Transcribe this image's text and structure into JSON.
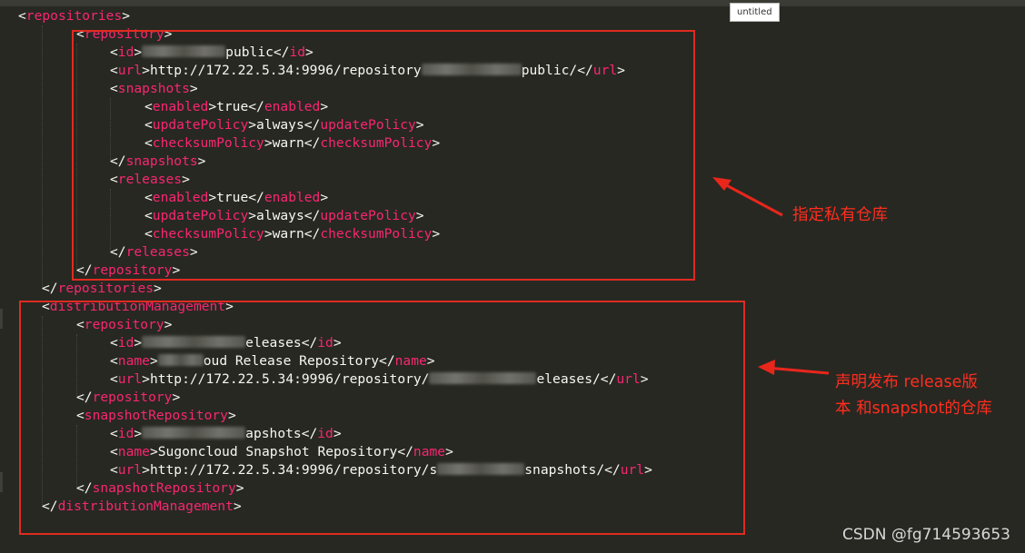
{
  "tab": {
    "label": "untitled"
  },
  "lines": [
    {
      "indent": 0,
      "parts": [
        [
          "br",
          "<"
        ],
        [
          "tn",
          "repositories"
        ],
        [
          "br",
          ">"
        ]
      ]
    },
    {
      "indent": 2,
      "parts": [
        [
          "br",
          "<"
        ],
        [
          "tn",
          "repository"
        ],
        [
          "br",
          ">"
        ]
      ]
    },
    {
      "indent": 3,
      "parts": [
        [
          "br",
          "<"
        ],
        [
          "tn",
          "id"
        ],
        [
          "br",
          ">"
        ],
        [
          "blur",
          ""
        ],
        [
          "tx",
          "public"
        ],
        [
          "br",
          "</"
        ],
        [
          "tn",
          "id"
        ],
        [
          "br",
          ">"
        ]
      ]
    },
    {
      "indent": 3,
      "parts": [
        [
          "br",
          "<"
        ],
        [
          "tn",
          "url"
        ],
        [
          "br",
          ">"
        ],
        [
          "tx",
          "http://172.22.5.34:9996/repository"
        ],
        [
          "blur",
          ""
        ],
        [
          "tx",
          "public/"
        ],
        [
          "br",
          "</"
        ],
        [
          "tn",
          "url"
        ],
        [
          "br",
          ">"
        ]
      ]
    },
    {
      "indent": 3,
      "parts": [
        [
          "br",
          "<"
        ],
        [
          "tn",
          "snapshots"
        ],
        [
          "br",
          ">"
        ]
      ]
    },
    {
      "indent": 4,
      "parts": [
        [
          "br",
          "<"
        ],
        [
          "tn",
          "enabled"
        ],
        [
          "br",
          ">"
        ],
        [
          "tx",
          "true"
        ],
        [
          "br",
          "</"
        ],
        [
          "tn",
          "enabled"
        ],
        [
          "br",
          ">"
        ]
      ]
    },
    {
      "indent": 4,
      "parts": [
        [
          "br",
          "<"
        ],
        [
          "tn",
          "updatePolicy"
        ],
        [
          "br",
          ">"
        ],
        [
          "tx",
          "always"
        ],
        [
          "br",
          "</"
        ],
        [
          "tn",
          "updatePolicy"
        ],
        [
          "br",
          ">"
        ]
      ]
    },
    {
      "indent": 4,
      "parts": [
        [
          "br",
          "<"
        ],
        [
          "tn",
          "checksumPolicy"
        ],
        [
          "br",
          ">"
        ],
        [
          "tx",
          "warn"
        ],
        [
          "br",
          "</"
        ],
        [
          "tn",
          "checksumPolicy"
        ],
        [
          "br",
          ">"
        ]
      ]
    },
    {
      "indent": 3,
      "parts": [
        [
          "br",
          "</"
        ],
        [
          "tn",
          "snapshots"
        ],
        [
          "br",
          ">"
        ]
      ]
    },
    {
      "indent": 3,
      "parts": [
        [
          "br",
          "<"
        ],
        [
          "tn",
          "releases"
        ],
        [
          "br",
          ">"
        ]
      ]
    },
    {
      "indent": 4,
      "parts": [
        [
          "br",
          "<"
        ],
        [
          "tn",
          "enabled"
        ],
        [
          "br",
          ">"
        ],
        [
          "tx",
          "true"
        ],
        [
          "br",
          "</"
        ],
        [
          "tn",
          "enabled"
        ],
        [
          "br",
          ">"
        ]
      ]
    },
    {
      "indent": 4,
      "parts": [
        [
          "br",
          "<"
        ],
        [
          "tn",
          "updatePolicy"
        ],
        [
          "br",
          ">"
        ],
        [
          "tx",
          "always"
        ],
        [
          "br",
          "</"
        ],
        [
          "tn",
          "updatePolicy"
        ],
        [
          "br",
          ">"
        ]
      ]
    },
    {
      "indent": 4,
      "parts": [
        [
          "br",
          "<"
        ],
        [
          "tn",
          "checksumPolicy"
        ],
        [
          "br",
          ">"
        ],
        [
          "tx",
          "warn"
        ],
        [
          "br",
          "</"
        ],
        [
          "tn",
          "checksumPolicy"
        ],
        [
          "br",
          ">"
        ]
      ]
    },
    {
      "indent": 3,
      "parts": [
        [
          "br",
          "</"
        ],
        [
          "tn",
          "releases"
        ],
        [
          "br",
          ">"
        ]
      ]
    },
    {
      "indent": 2,
      "parts": [
        [
          "br",
          "</"
        ],
        [
          "tn",
          "repository"
        ],
        [
          "br",
          ">"
        ]
      ]
    },
    {
      "indent": 1,
      "parts": [
        [
          "br",
          "</"
        ],
        [
          "tn",
          "repositories"
        ],
        [
          "br",
          ">"
        ]
      ]
    },
    {
      "indent": 1,
      "parts": [
        [
          "br",
          "<"
        ],
        [
          "tn",
          "distributionManagement"
        ],
        [
          "br",
          ">"
        ]
      ]
    },
    {
      "indent": 2,
      "parts": [
        [
          "br",
          "<"
        ],
        [
          "tn",
          "repository"
        ],
        [
          "br",
          ">"
        ]
      ]
    },
    {
      "indent": 3,
      "parts": [
        [
          "br",
          "<"
        ],
        [
          "tn",
          "id"
        ],
        [
          "br",
          ">"
        ],
        [
          "blur",
          ""
        ],
        [
          "tx",
          "eleases"
        ],
        [
          "br",
          "</"
        ],
        [
          "tn",
          "id"
        ],
        [
          "br",
          ">"
        ]
      ]
    },
    {
      "indent": 3,
      "parts": [
        [
          "br",
          "<"
        ],
        [
          "tn",
          "name"
        ],
        [
          "br",
          ">"
        ],
        [
          "blur",
          ""
        ],
        [
          "tx",
          "oud Release Repository"
        ],
        [
          "br",
          "</"
        ],
        [
          "tn",
          "name"
        ],
        [
          "br",
          ">"
        ]
      ]
    },
    {
      "indent": 3,
      "parts": [
        [
          "br",
          "<"
        ],
        [
          "tn",
          "url"
        ],
        [
          "br",
          ">"
        ],
        [
          "tx",
          "http://172.22.5.34:9996/repository/"
        ],
        [
          "blur",
          ""
        ],
        [
          "tx",
          "eleases/"
        ],
        [
          "br",
          "</"
        ],
        [
          "tn",
          "url"
        ],
        [
          "br",
          ">"
        ]
      ]
    },
    {
      "indent": 2,
      "parts": [
        [
          "br",
          "</"
        ],
        [
          "tn",
          "repository"
        ],
        [
          "br",
          ">"
        ]
      ]
    },
    {
      "indent": 2,
      "parts": [
        [
          "br",
          "<"
        ],
        [
          "tn",
          "snapshotRepository"
        ],
        [
          "br",
          ">"
        ]
      ]
    },
    {
      "indent": 3,
      "parts": [
        [
          "br",
          "<"
        ],
        [
          "tn",
          "id"
        ],
        [
          "br",
          ">"
        ],
        [
          "blur",
          ""
        ],
        [
          "tx",
          "apshots"
        ],
        [
          "br",
          "</"
        ],
        [
          "tn",
          "id"
        ],
        [
          "br",
          ">"
        ]
      ]
    },
    {
      "indent": 3,
      "parts": [
        [
          "br",
          "<"
        ],
        [
          "tn",
          "name"
        ],
        [
          "br",
          ">"
        ],
        [
          "tx",
          "Sugoncloud Snapshot Repository"
        ],
        [
          "br",
          "</"
        ],
        [
          "tn",
          "name"
        ],
        [
          "br",
          ">"
        ]
      ]
    },
    {
      "indent": 3,
      "parts": [
        [
          "br",
          "<"
        ],
        [
          "tn",
          "url"
        ],
        [
          "br",
          ">"
        ],
        [
          "tx",
          "http://172.22.5.34:9996/repository/s"
        ],
        [
          "blur",
          ""
        ],
        [
          "tx",
          "snapshots/"
        ],
        [
          "br",
          "</"
        ],
        [
          "tn",
          "url"
        ],
        [
          "br",
          ">"
        ]
      ]
    },
    {
      "indent": 2,
      "parts": [
        [
          "br",
          "</"
        ],
        [
          "tn",
          "snapshotRepository"
        ],
        [
          "br",
          ">"
        ]
      ]
    },
    {
      "indent": 1,
      "parts": [
        [
          "br",
          "</"
        ],
        [
          "tn",
          "distributionManagement"
        ],
        [
          "br",
          ">"
        ]
      ]
    }
  ],
  "annotations": {
    "note1": "指定私有仓库",
    "note2_line1": "声明发布 release版",
    "note2_line2": "本 和snapshot的仓库"
  },
  "watermark": "CSDN @fg714593653",
  "colors": {
    "background": "#272822",
    "tag": "#f92672",
    "text": "#f8f8f2",
    "annotation": "#ff2d1f"
  }
}
